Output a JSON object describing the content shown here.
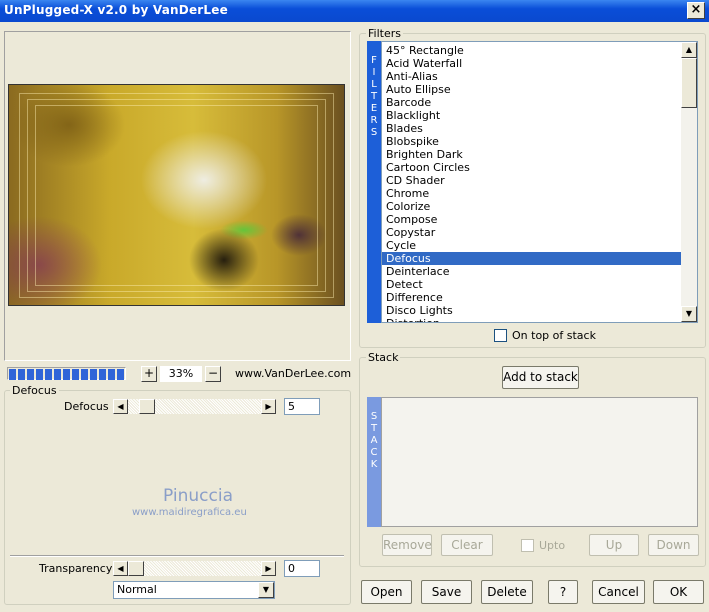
{
  "window": {
    "title": "UnPlugged-X v2.0 by VanDerLee",
    "close_label": "×"
  },
  "preview": {
    "zoom": "33%",
    "zoom_in": "+",
    "zoom_out": "−",
    "url": "www.VanDerLee.com",
    "progress": 1.0
  },
  "filters": {
    "group_label": "Filters",
    "vertical_label": "FILTERS",
    "items": [
      "45° Rectangle",
      "Acid Waterfall",
      "Anti-Alias",
      "Auto Ellipse",
      "Barcode",
      "Blacklight",
      "Blades",
      "Blobspike",
      "Brighten Dark",
      "Cartoon Circles",
      "CD Shader",
      "Chrome",
      "Colorize",
      "Compose",
      "Copystar",
      "Cycle",
      "Defocus",
      "Deinterlace",
      "Detect",
      "Difference",
      "Disco Lights",
      "Distortion"
    ],
    "selected": "Defocus",
    "on_top_label": "On top of stack",
    "on_top_checked": false
  },
  "stack": {
    "group_label": "Stack",
    "vertical_label": "STACK",
    "add_label": "Add to stack",
    "remove_label": "Remove",
    "clear_label": "Clear",
    "upto_label": "Upto",
    "up_label": "Up",
    "down_label": "Down"
  },
  "params": {
    "group_label": "Defocus",
    "defocus_label": "Defocus",
    "defocus_value": "5",
    "watermark_name": "Pinuccia",
    "watermark_url": "www.maidiregrafica.eu",
    "transparency_label": "Transparency",
    "transparency_value": "0",
    "blend_mode": "Normal"
  },
  "bottom": {
    "open": "Open",
    "save": "Save",
    "delete": "Delete",
    "help": "?",
    "cancel": "Cancel",
    "ok": "OK"
  },
  "colors": {
    "titlebar": "#0a4ed8",
    "selection": "#316ac5",
    "filters_bar": "#1d5fd8",
    "stack_bar": "#7a9ae0"
  }
}
